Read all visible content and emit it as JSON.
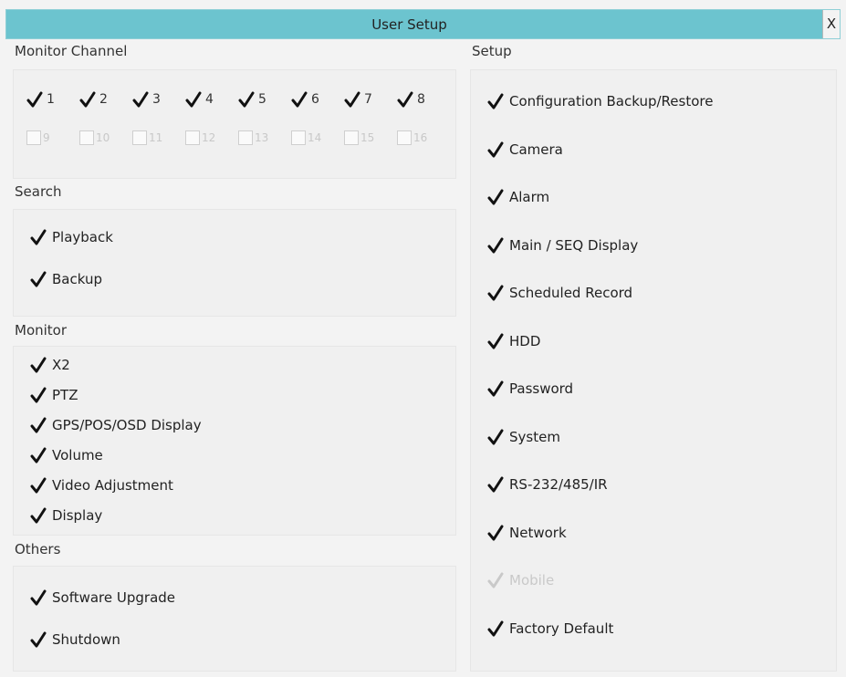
{
  "window": {
    "title": "User Setup",
    "close_label": "X"
  },
  "left": {
    "monitor_channel": {
      "title": "Monitor Channel",
      "row1": [
        {
          "label": "1",
          "checked": true
        },
        {
          "label": "2",
          "checked": true
        },
        {
          "label": "3",
          "checked": true
        },
        {
          "label": "4",
          "checked": true
        },
        {
          "label": "5",
          "checked": true
        },
        {
          "label": "6",
          "checked": true
        },
        {
          "label": "7",
          "checked": true
        },
        {
          "label": "8",
          "checked": true
        }
      ],
      "row2": [
        {
          "label": "9",
          "checked": false
        },
        {
          "label": "10",
          "checked": false
        },
        {
          "label": "11",
          "checked": false
        },
        {
          "label": "12",
          "checked": false
        },
        {
          "label": "13",
          "checked": false
        },
        {
          "label": "14",
          "checked": false
        },
        {
          "label": "15",
          "checked": false
        },
        {
          "label": "16",
          "checked": false
        }
      ]
    },
    "search": {
      "title": "Search",
      "items": [
        {
          "label": "Playback",
          "checked": true
        },
        {
          "label": "Backup",
          "checked": true
        }
      ]
    },
    "monitor": {
      "title": "Monitor",
      "items": [
        {
          "label": "X2",
          "checked": true
        },
        {
          "label": "PTZ",
          "checked": true
        },
        {
          "label": "GPS/POS/OSD Display",
          "checked": true
        },
        {
          "label": "Volume",
          "checked": true
        },
        {
          "label": "Video Adjustment",
          "checked": true
        },
        {
          "label": "Display",
          "checked": true
        }
      ]
    },
    "others": {
      "title": "Others",
      "items": [
        {
          "label": "Software Upgrade",
          "checked": true
        },
        {
          "label": "Shutdown",
          "checked": true
        }
      ]
    }
  },
  "right": {
    "setup": {
      "title": "Setup",
      "items": [
        {
          "label": "Configuration Backup/Restore",
          "checked": true,
          "enabled": true
        },
        {
          "label": "Camera",
          "checked": true,
          "enabled": true
        },
        {
          "label": "Alarm",
          "checked": true,
          "enabled": true
        },
        {
          "label": "Main / SEQ Display",
          "checked": true,
          "enabled": true
        },
        {
          "label": "Scheduled Record",
          "checked": true,
          "enabled": true
        },
        {
          "label": "HDD",
          "checked": true,
          "enabled": true
        },
        {
          "label": "Password",
          "checked": true,
          "enabled": true
        },
        {
          "label": "System",
          "checked": true,
          "enabled": true
        },
        {
          "label": "RS-232/485/IR",
          "checked": true,
          "enabled": true
        },
        {
          "label": "Network",
          "checked": true,
          "enabled": true
        },
        {
          "label": "Mobile",
          "checked": true,
          "enabled": false
        },
        {
          "label": "Factory Default",
          "checked": true,
          "enabled": true
        }
      ]
    }
  },
  "colors": {
    "titlebar": "#6cc4cf",
    "background": "#f3f3f3",
    "panel": "#f0f0f0",
    "check": "#111111",
    "disabled": "#c9c9c9"
  }
}
